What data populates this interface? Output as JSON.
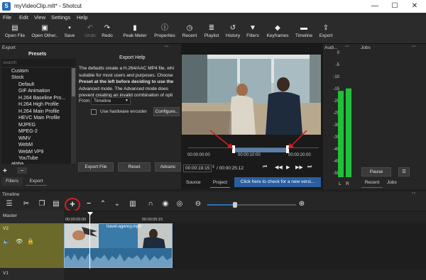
{
  "window": {
    "title": "myVideoClip.mlt* - Shotcut",
    "minimize": "—",
    "maximize": "☐",
    "close": "✕"
  },
  "menu": [
    "File",
    "Edit",
    "View",
    "Settings",
    "Help"
  ],
  "toolbar": [
    {
      "icon": "open-file-icon",
      "glyph": "▤",
      "label": "Open File"
    },
    {
      "icon": "open-other-icon",
      "glyph": "▣",
      "label": "Open Other.."
    },
    {
      "icon": "save-icon",
      "glyph": "▪",
      "label": "Save"
    },
    {
      "icon": "undo-icon",
      "glyph": "↶",
      "label": "Undo",
      "disabled": true
    },
    {
      "icon": "redo-icon",
      "glyph": "↷",
      "label": "Redo"
    },
    {
      "icon": "peak-meter-icon",
      "glyph": "▮",
      "label": "Peak Meter"
    },
    {
      "icon": "properties-icon",
      "glyph": "ⓘ",
      "label": "Properties"
    },
    {
      "icon": "recent-icon",
      "glyph": "◷",
      "label": "Recent"
    },
    {
      "icon": "playlist-icon",
      "glyph": "≣",
      "label": "Playlist"
    },
    {
      "icon": "history-icon",
      "glyph": "↺",
      "label": "History"
    },
    {
      "icon": "filters-icon",
      "glyph": "▼",
      "label": "Filters"
    },
    {
      "icon": "keyframes-icon",
      "glyph": "◆",
      "label": "Keyframes"
    },
    {
      "icon": "timeline-icon",
      "glyph": "▬",
      "label": "Timeline"
    },
    {
      "icon": "export-icon",
      "glyph": "⇪",
      "label": "Export"
    }
  ],
  "export": {
    "panel_title": "Export",
    "presets_title": "Presets",
    "search_placeholder": "search",
    "presets": [
      "Custom",
      "Stock",
      "Default",
      "GIF Animation",
      "H.264 Baseline Pro...",
      "H.264 High Profile",
      "H.264 Main Profile",
      "HEVC Main Profile",
      "MJPEG",
      "MPEG-2",
      "WMV",
      "WebM",
      "WebM VP9",
      "YouTube",
      "alpha"
    ],
    "help_title": "Export Help",
    "help_lines": [
      "The defaults create a H.264/AAC MP4 file, whi",
      "suitable for most users and purposes. Choose",
      "Preset at the left before deciding to use the",
      "Advanced mode. The Advanced mode does",
      "prevent creating an invalid combination of opti"
    ],
    "from_label": "From",
    "from_value": "Timeline",
    "hw_encoder_label": "Use hardware encoder",
    "configure_label": "Configure..",
    "export_file": "Export File",
    "reset": "Reset",
    "advanced": "Advanc",
    "tabs": [
      "Filters",
      "Export"
    ],
    "add": "+",
    "remove": "−"
  },
  "player": {
    "ruler_start": "00:00:00:00",
    "ruler_mid": "00:00:10:00",
    "ruler_end": "00:00:20:00",
    "position": "00:00:19:15",
    "duration": "/ 00:00:25:12",
    "tabs": [
      "Source",
      "Project"
    ],
    "update_notice": "Click here to check for a new versi..."
  },
  "audio": {
    "title": "Audi...",
    "scale": [
      "0",
      "-5",
      "-10",
      "-15",
      "-20",
      "-25",
      "-30",
      "-35",
      "-40",
      "-45",
      "-50"
    ],
    "left": "L",
    "right": "R",
    "level_left_db": -15,
    "level_right_db": -14
  },
  "jobs": {
    "title": "Jobs",
    "pause": "Pause",
    "menu": "☰",
    "tabs": [
      "Recent",
      "Jobs"
    ]
  },
  "timeline": {
    "title": "Timeline",
    "tracks": [
      {
        "name": "Master"
      },
      {
        "name": "V2"
      },
      {
        "name": "V1"
      }
    ],
    "ruler": [
      "00:00:00:00",
      "00:00:05:15"
    ],
    "clip": "travel-agency.mp4"
  },
  "colors": {
    "accent": "#2a6fb0",
    "highlight": "#d32020",
    "meter": "#21c03a"
  }
}
